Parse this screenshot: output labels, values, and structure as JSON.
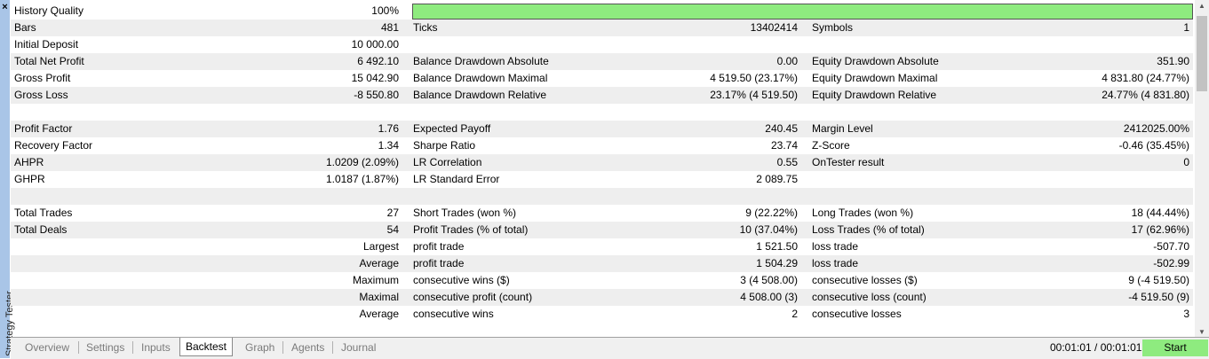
{
  "panel": {
    "title": "Strategy Tester",
    "close_glyph": "×"
  },
  "report": {
    "history_quality": {
      "label": "History Quality",
      "value": "100%",
      "fill_fraction": 1.0
    },
    "rows": [
      [
        "Bars",
        "481",
        "Ticks",
        "13402414",
        "Symbols",
        "1"
      ],
      [
        "Initial Deposit",
        "10 000.00",
        "",
        "",
        "",
        ""
      ],
      [
        "Total Net Profit",
        "6 492.10",
        "Balance Drawdown Absolute",
        "0.00",
        "Equity Drawdown Absolute",
        "351.90"
      ],
      [
        "Gross Profit",
        "15 042.90",
        "Balance Drawdown Maximal",
        "4 519.50 (23.17%)",
        "Equity Drawdown Maximal",
        "4 831.80 (24.77%)"
      ],
      [
        "Gross Loss",
        "-8 550.80",
        "Balance Drawdown Relative",
        "23.17% (4 519.50)",
        "Equity Drawdown Relative",
        "24.77% (4 831.80)"
      ],
      [
        "",
        "",
        "",
        "",
        "",
        ""
      ],
      [
        "Profit Factor",
        "1.76",
        "Expected Payoff",
        "240.45",
        "Margin Level",
        "2412025.00%"
      ],
      [
        "Recovery Factor",
        "1.34",
        "Sharpe Ratio",
        "23.74",
        "Z-Score",
        "-0.46 (35.45%)"
      ],
      [
        "AHPR",
        "1.0209 (2.09%)",
        "LR Correlation",
        "0.55",
        "OnTester result",
        "0"
      ],
      [
        "GHPR",
        "1.0187 (1.87%)",
        "LR Standard Error",
        "2 089.75",
        "",
        ""
      ],
      [
        "",
        "",
        "",
        "",
        "",
        ""
      ],
      [
        "Total Trades",
        "27",
        "Short Trades (won %)",
        "9 (22.22%)",
        "Long Trades (won %)",
        "18 (44.44%)"
      ],
      [
        "Total Deals",
        "54",
        "Profit Trades (% of total)",
        "10 (37.04%)",
        "Loss Trades (% of total)",
        "17 (62.96%)"
      ],
      [
        "",
        "Largest",
        "profit trade",
        "1 521.50",
        "loss trade",
        "-507.70"
      ],
      [
        "",
        "Average",
        "profit trade",
        "1 504.29",
        "loss trade",
        "-502.99"
      ],
      [
        "",
        "Maximum",
        "consecutive wins ($)",
        "3 (4 508.00)",
        "consecutive losses ($)",
        "9 (-4 519.50)"
      ],
      [
        "",
        "Maximal",
        "consecutive profit (count)",
        "4 508.00 (3)",
        "consecutive loss (count)",
        "-4 519.50 (9)"
      ],
      [
        "",
        "Average",
        "consecutive wins",
        "2",
        "consecutive losses",
        "3"
      ]
    ]
  },
  "tabs": [
    "Overview",
    "Settings",
    "Inputs",
    "Backtest",
    "Graph",
    "Agents",
    "Journal"
  ],
  "active_tab": "Backtest",
  "timer": "00:01:01 / 00:01:01",
  "start_label": "Start",
  "colors": {
    "accent_green": "#8eeb7f",
    "panel_blue": "#a9c5e7",
    "row_alt": "#eeeeee"
  }
}
